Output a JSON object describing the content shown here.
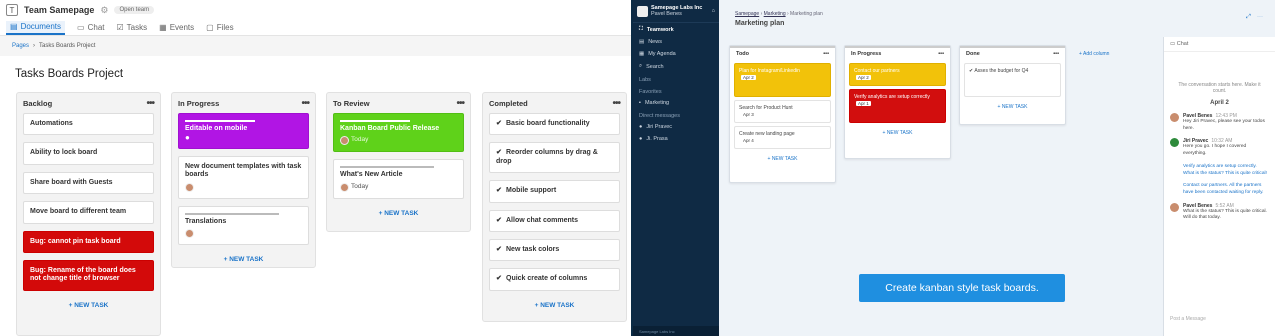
{
  "left": {
    "team_title": "Team Samepage",
    "open_team": "Open team",
    "tabs": [
      {
        "label": "Documents",
        "icon": "document-icon"
      },
      {
        "label": "Chat",
        "icon": "chat-icon"
      },
      {
        "label": "Tasks",
        "icon": "tasks-icon"
      },
      {
        "label": "Events",
        "icon": "calendar-icon"
      },
      {
        "label": "Files",
        "icon": "folder-icon"
      }
    ],
    "breadcrumb": {
      "root": "Pages",
      "sep": "›",
      "current": "Tasks Boards Project"
    },
    "page_title": "Tasks Boards Project",
    "new_task": "+ NEW TASK",
    "columns": [
      {
        "title": "Backlog",
        "cards": [
          {
            "text": "Automations"
          },
          {
            "text": "Ability to lock board"
          },
          {
            "text": "Share board with Guests"
          },
          {
            "text": "Move board to different team"
          },
          {
            "text": "Bug: cannot pin task board",
            "color": "red"
          },
          {
            "text": "Bug: Rename of the board does not change title of browser",
            "color": "red"
          }
        ]
      },
      {
        "title": "In Progress",
        "cards": [
          {
            "text": "Editable on mobile",
            "color": "purple"
          },
          {
            "text": "New document templates with task boards"
          },
          {
            "text": "Translations"
          }
        ]
      },
      {
        "title": "To Review",
        "cards": [
          {
            "text": "Kanban Board Public Release",
            "color": "green",
            "date": "Today"
          },
          {
            "text": "What's New Article",
            "date": "Today"
          }
        ]
      },
      {
        "title": "Completed",
        "cards": [
          {
            "text": "Basic board functionality"
          },
          {
            "text": "Reorder columns by drag & drop"
          },
          {
            "text": "Mobile support"
          },
          {
            "text": "Allow chat comments"
          },
          {
            "text": "New task colors"
          },
          {
            "text": "Quick create of columns"
          }
        ]
      }
    ]
  },
  "right": {
    "org_name": "Samepage Labs Inc",
    "org_sub": "Pavel Benes",
    "nav": [
      {
        "label": "Teamwork",
        "bold": true
      },
      {
        "label": "News"
      },
      {
        "label": "My Agenda"
      },
      {
        "label": "Search"
      }
    ],
    "sections": {
      "labs": "Labs",
      "favorites": "Favorites",
      "direct": "Direct messages"
    },
    "favorites": [
      "Marketing"
    ],
    "direct_messages": [
      "Jiri Pravec",
      "Ji. Prasa"
    ],
    "footer": "Samepage Labs Inc",
    "breadcrumb": [
      "Samepage",
      "Marketing",
      "Marketing plan"
    ],
    "title": "Marketing plan",
    "add_column": "+ Add column",
    "new_task": "+ NEW TASK",
    "columns": [
      {
        "title": "Todo",
        "cards": [
          {
            "text": "Plan for Instagram/Linkedin",
            "color": "y",
            "date": "Apr 2"
          },
          {
            "text": "Search for Product Hunt",
            "date": "Apr 3"
          },
          {
            "text": "Create new landing page",
            "date": "Apr 4"
          }
        ]
      },
      {
        "title": "In Progress",
        "cards": [
          {
            "text": "Contact our partners",
            "color": "y",
            "date": "Apr 2"
          },
          {
            "text": "Verify analytics are setup correctly",
            "color": "r",
            "date": "Apr 1"
          }
        ]
      },
      {
        "title": "Done",
        "cards": [
          {
            "text": "Asses the budget for Q4"
          }
        ]
      }
    ],
    "banner": "Create kanban style task boards.",
    "chat": {
      "title": "Chat",
      "note": "The conversation starts here. Make it count.",
      "day": "April 2",
      "messages": [
        {
          "name": "Pavel Benes",
          "time": "12:43 PM",
          "text": "Hey Jiri Pravec, please see your todos here."
        },
        {
          "name": "Jiri Pravec",
          "time": "10:32 AM",
          "text": "Here you go. I hope I covered everything."
        },
        {
          "name": "",
          "time": "",
          "text": "Verify analytics are setup correctly. What is the status? This is quite critical!"
        },
        {
          "name": "",
          "time": "",
          "text": "Contact our partners. All the partners have been contacted waiting for reply."
        },
        {
          "name": "Pavel Benes",
          "time": "5:52 AM",
          "text": "What is the status? This is quite critical. Will do that today."
        }
      ],
      "input_placeholder": "Post a Message"
    }
  }
}
